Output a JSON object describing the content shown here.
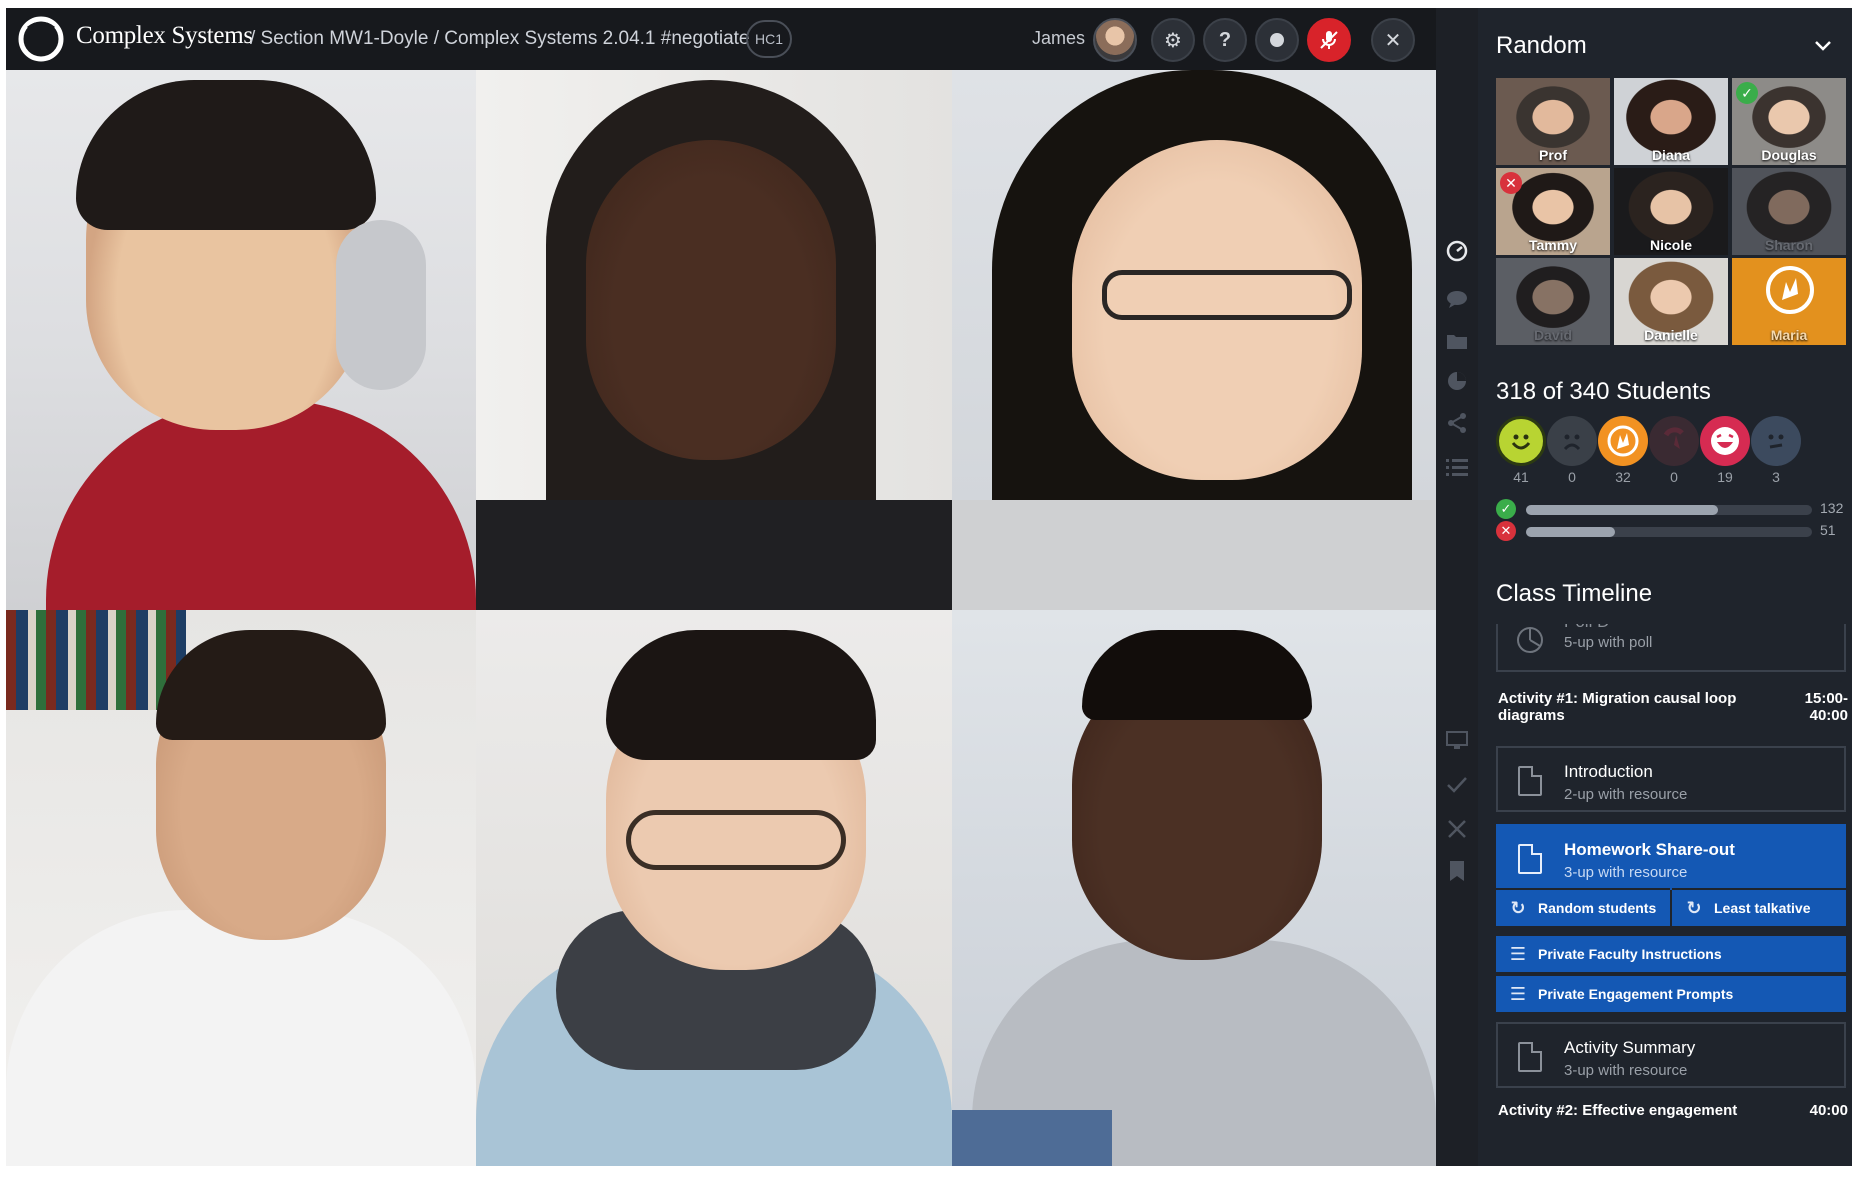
{
  "topbar": {
    "brand": "Complex Systems",
    "breadcrumb": "/ Section MW1-Doyle / Complex Systems 2.04.1 #negotiate",
    "badge": "HC1",
    "user_name": "James",
    "icons": [
      "gear-icon",
      "help-icon",
      "record-icon",
      "mic-muted-icon",
      "close-icon"
    ],
    "colors": {
      "mute_button": "#d8232a"
    }
  },
  "video_grid": {
    "tiles": [
      {
        "name": "video-tile-1"
      },
      {
        "name": "video-tile-2"
      },
      {
        "name": "video-tile-3"
      },
      {
        "name": "video-tile-4"
      },
      {
        "name": "video-tile-5"
      },
      {
        "name": "video-tile-6"
      }
    ]
  },
  "rail": {
    "icons": [
      "gauge-icon",
      "chat-icon",
      "folder-icon",
      "pie-chart-icon",
      "share-icon",
      "list-icon",
      "monitor-icon",
      "check-icon",
      "close-icon",
      "bookmark-icon"
    ]
  },
  "panel": {
    "title": "Random",
    "thumbnails": [
      {
        "name": "Prof",
        "status": ""
      },
      {
        "name": "Diana",
        "status": ""
      },
      {
        "name": "Douglas",
        "status": "check"
      },
      {
        "name": "Tammy",
        "status": "x"
      },
      {
        "name": "Nicole",
        "status": ""
      },
      {
        "name": "Sharon",
        "status": "dim"
      },
      {
        "name": "David",
        "status": "dim"
      },
      {
        "name": "Danielle",
        "status": ""
      },
      {
        "name": "Maria",
        "status": "hand"
      }
    ],
    "students": "318 of 340 Students",
    "reactions": [
      {
        "icon": "smile-icon",
        "count": "41",
        "color": "#b8d432"
      },
      {
        "icon": "sad-icon",
        "count": "0",
        "color": "#3a4048"
      },
      {
        "icon": "hand-raise-icon",
        "count": "32",
        "color": "#f29222"
      },
      {
        "icon": "hand-down-icon",
        "count": "0",
        "color": "#3a2a32"
      },
      {
        "icon": "laugh-icon",
        "count": "19",
        "color": "#d62b52"
      },
      {
        "icon": "confused-icon",
        "count": "3",
        "color": "#3c4a5e"
      }
    ],
    "poll_bars": [
      {
        "icon": "check-icon",
        "value": "132",
        "fraction": 0.67,
        "color": "#3aad4a"
      },
      {
        "icon": "x-icon",
        "value": "51",
        "fraction": 0.31,
        "color": "#d8323c"
      }
    ],
    "timeline_title": "Class Timeline",
    "timeline": {
      "poll_card": {
        "title": "Poll D",
        "subtitle": "5-up with poll"
      },
      "activity1": {
        "title": "Activity #1: Migration causal loop diagrams",
        "time": "15:00-40:00"
      },
      "intro_card": {
        "title": "Introduction",
        "subtitle": "2-up with resource"
      },
      "homework_card": {
        "title": "Homework Share-out",
        "subtitle": "3-up with resource"
      },
      "random_students": "Random students",
      "least_talkative": "Least talkative",
      "faculty_instructions": "Private Faculty Instructions",
      "engagement_prompts": "Private Engagement Prompts",
      "summary_card": {
        "title": "Activity Summary",
        "subtitle": "3-up with resource"
      },
      "activity2": {
        "title": "Activity #2: Effective engagement",
        "time": "40:00"
      }
    }
  }
}
